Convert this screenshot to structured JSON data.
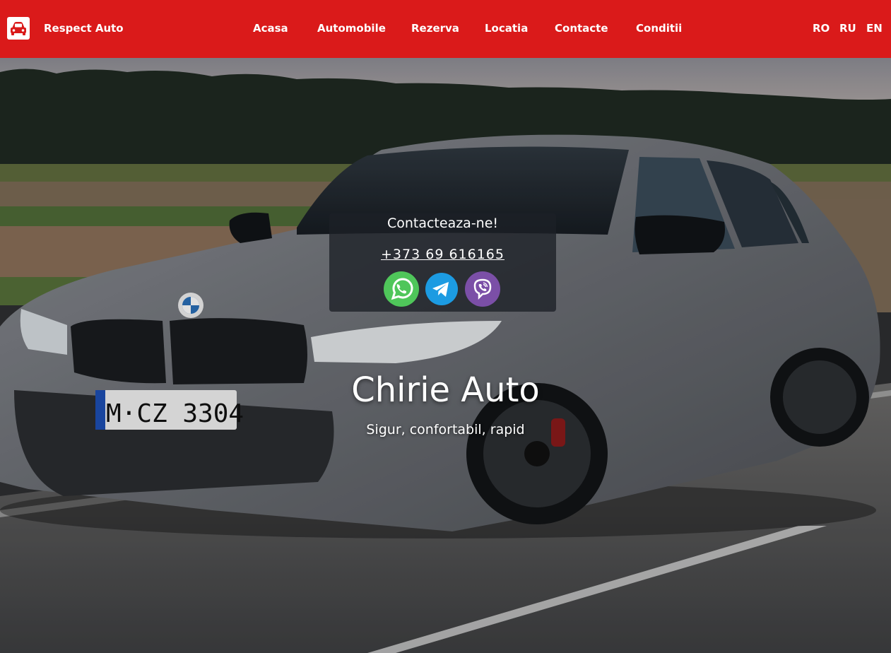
{
  "header": {
    "brand": "Respect Auto",
    "logo_icon": "car-icon",
    "nav": [
      "Acasa",
      "Automobile",
      "Rezerva",
      "Locatia",
      "Contacte",
      "Conditii"
    ],
    "languages": [
      "RO",
      "RU",
      "EN"
    ]
  },
  "contact": {
    "title": "Contacteaza-ne!",
    "phone": "+373 69 616165",
    "socials": [
      {
        "name": "whatsapp-icon",
        "color": "#4fc65a"
      },
      {
        "name": "telegram-icon",
        "color": "#1c9be2"
      },
      {
        "name": "viber-icon",
        "color": "#7b4fa7"
      }
    ]
  },
  "hero": {
    "title": "Chirie Auto",
    "subtitle": "Sigur, confortabil, rapid"
  },
  "colors": {
    "header_bg": "#da1a1a",
    "text": "#ffffff"
  }
}
